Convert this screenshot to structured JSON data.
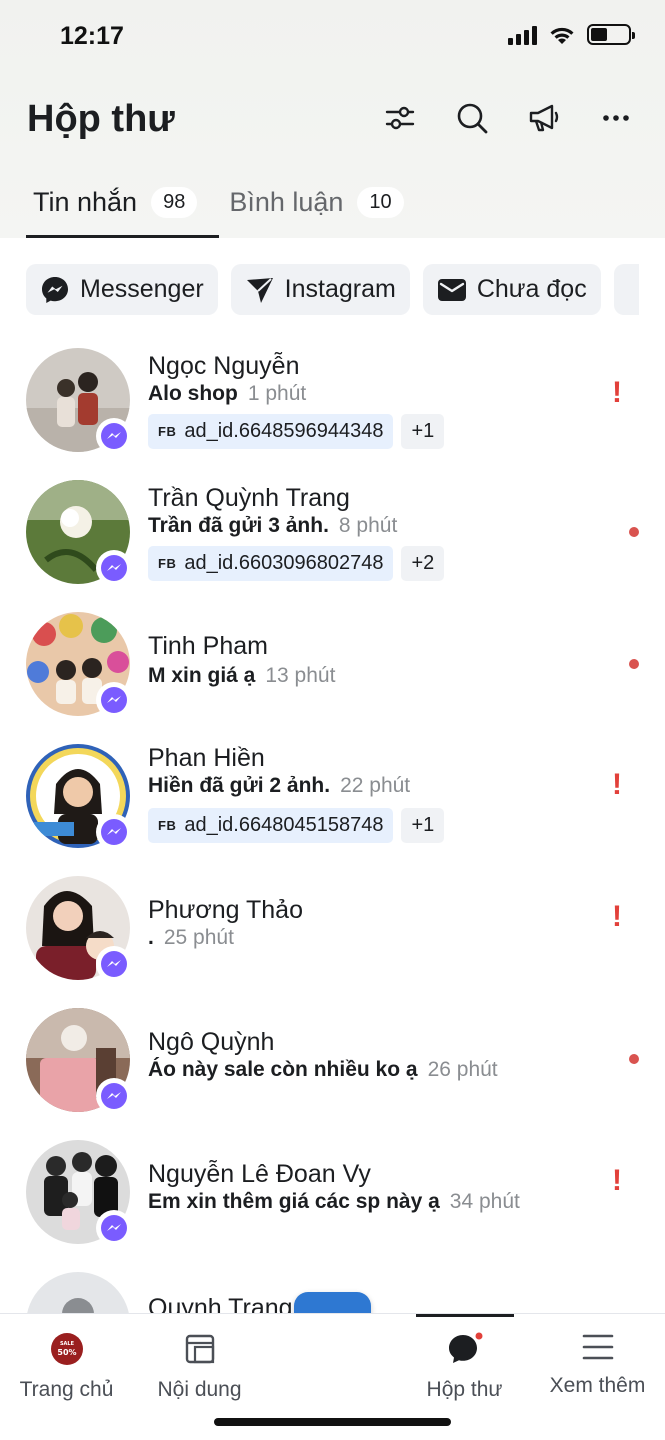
{
  "status_bar": {
    "time": "12:17",
    "battery_level": 0.45
  },
  "header": {
    "title": "Hộp thư",
    "actions": [
      "filter-sliders-icon",
      "search-icon",
      "megaphone-icon",
      "more-icon"
    ]
  },
  "tabs": [
    {
      "label": "Tin nhắn",
      "count": "98",
      "active": true
    },
    {
      "label": "Bình luận",
      "count": "10",
      "active": false
    }
  ],
  "filters": [
    {
      "label": "Messenger",
      "icon": "messenger-icon"
    },
    {
      "label": "Instagram",
      "icon": "send-icon"
    },
    {
      "label": "Chưa đọc",
      "icon": "mail-icon"
    }
  ],
  "conversations": [
    {
      "name": "Ngọc Nguyễn",
      "preview": "Alo shop",
      "time": "1 phút",
      "tag": "ad_id.6648596944348",
      "tag_prefix": "FB",
      "extra": "+1",
      "status": "!"
    },
    {
      "name": "Trần Quỳnh Trang",
      "preview": "Trần đã gửi 3 ảnh.",
      "time": "8 phút",
      "tag": "ad_id.6603096802748",
      "tag_prefix": "FB",
      "extra": "+2",
      "status": "dot"
    },
    {
      "name": "Tinh Pham",
      "preview": "M xin giá ạ",
      "time": "13 phút",
      "status": "dot"
    },
    {
      "name": "Phan Hiền",
      "preview": "Hiền đã gửi 2 ảnh.",
      "time": "22 phút",
      "tag": "ad_id.6648045158748",
      "tag_prefix": "FB",
      "extra": "+1",
      "status": "!"
    },
    {
      "name": "Phương Thảo",
      "preview": ".",
      "time": "25 phút",
      "status": "!"
    },
    {
      "name": "Ngô Quỳnh",
      "preview": "Áo này sale còn nhiều ko ạ",
      "time": "26 phút",
      "status": "dot"
    },
    {
      "name": "Nguyễn Lê Đoan Vy",
      "preview": "Em xin thêm giá các sp này ạ",
      "time": "34 phút",
      "status": "!"
    },
    {
      "name": "Quynh Trang"
    }
  ],
  "bottom_nav": [
    {
      "label": "Trang chủ",
      "icon": "home-sale-avatar-icon",
      "avatar_text_1": "SALE",
      "avatar_text_2": "50%"
    },
    {
      "label": "Nội dung",
      "icon": "content-icon"
    },
    {
      "label": "Hộp thư",
      "icon": "inbox-chat-icon",
      "active": true
    },
    {
      "label": "Xem thêm",
      "icon": "menu-icon"
    }
  ],
  "fab_icon": "plus-icon",
  "colors": {
    "accent": "#2e78d2",
    "unread_dot": "#d9534f",
    "warning": "#e2403a",
    "tag_bg": "#e7f0fd",
    "chip_bg": "#f0f2f5"
  }
}
